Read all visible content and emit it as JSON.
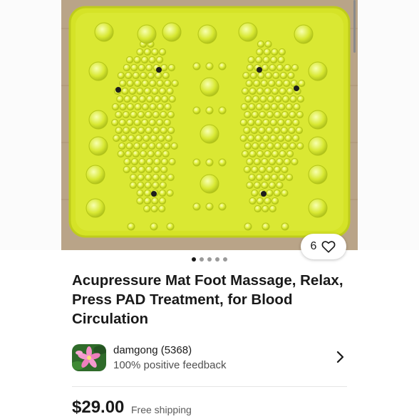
{
  "listing": {
    "title": "Acupressure Mat Foot Massage, Relax, Press PAD Treatment, for Blood Circulation",
    "watch_count": "6",
    "image_count": 5,
    "current_image": 1
  },
  "seller": {
    "name": "damgong (5368)",
    "feedback": "100% positive feedback"
  },
  "pricing": {
    "price": "$29.00",
    "shipping": "Free shipping"
  },
  "icons": {
    "watch": "heart-icon",
    "seller_link": "chevron-right-icon"
  },
  "colors": {
    "mat": "#e4ee3a",
    "text_primary": "#191919",
    "text_secondary": "#5a5a5a"
  }
}
